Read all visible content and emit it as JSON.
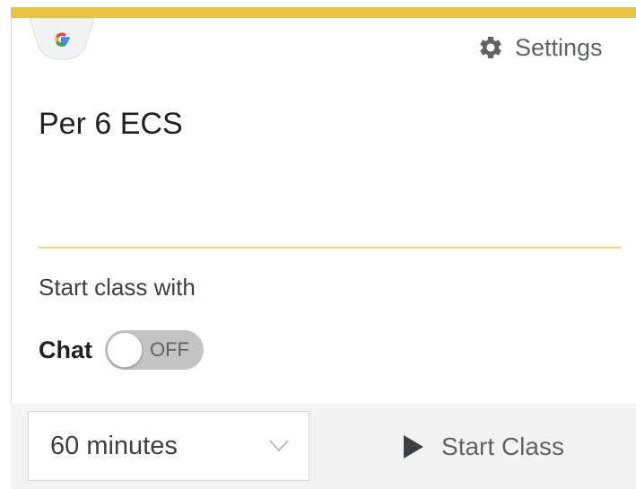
{
  "header": {
    "logo_icon": "google-g-icon",
    "settings_icon": "gear-icon",
    "settings_label": "Settings"
  },
  "class": {
    "title": "Per 6 ECS"
  },
  "start_options": {
    "heading": "Start class with",
    "chat_label": "Chat",
    "chat_toggle_state": "OFF",
    "chat_enabled": false
  },
  "footer": {
    "duration_value": "60 minutes",
    "duration_chevron_icon": "chevron-down-icon",
    "start_icon": "play-icon",
    "start_label": "Start Class"
  },
  "colors": {
    "accent": "#e8c33f",
    "divider": "#ebd976",
    "toggle_off": "#c4c4c4",
    "footer_bg": "#f3f3f3"
  }
}
